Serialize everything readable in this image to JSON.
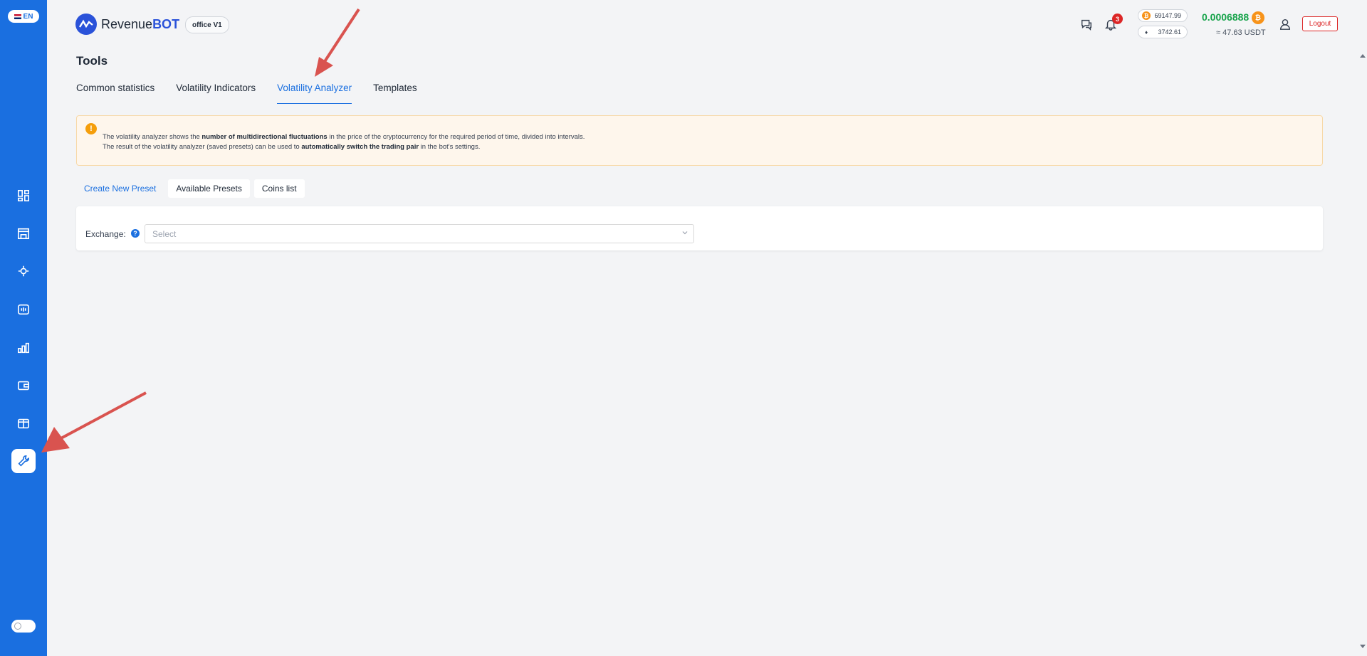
{
  "sidebar": {
    "lang": "EN",
    "items": [
      {
        "icon": "dashboard-icon"
      },
      {
        "icon": "marketplace-icon"
      },
      {
        "icon": "bots-icon"
      },
      {
        "icon": "terminal-icon"
      },
      {
        "icon": "statistics-icon"
      },
      {
        "icon": "wallet-icon"
      },
      {
        "icon": "tariffs-icon"
      },
      {
        "icon": "tools-icon",
        "active": true
      }
    ]
  },
  "header": {
    "brand": {
      "plain": "Revenue",
      "bold": "BOT"
    },
    "office": "office V1",
    "notifications": "3",
    "tickers": [
      {
        "coin": "₿",
        "color": "#f7931a",
        "value": "69147.99"
      },
      {
        "coin": "♦",
        "color": "#6b7280",
        "value": "3742.61"
      }
    ],
    "balance_btc": "0.0006888",
    "balance_usdt": "≈ 47.63 USDT",
    "logout": "Logout"
  },
  "page": {
    "title": "Tools",
    "tabs": [
      "Common statistics",
      "Volatility Indicators",
      "Volatility Analyzer",
      "Templates"
    ],
    "active_tab": 2
  },
  "alert": {
    "line1_pre": "The volatility analyzer shows the ",
    "line1_bold": "number of multidirectional fluctuations",
    "line1_post": " in the price of the cryptocurrency for the required period of time, divided into intervals.",
    "line2_pre": "The result of the volatility analyzer (saved presets) can be used to ",
    "line2_bold": "automatically switch the trading pair",
    "line2_post": " in the bot's settings."
  },
  "subtabs": [
    "Create New Preset",
    "Available Presets",
    "Coins list"
  ],
  "form": {
    "exchange_label": "Exchange:",
    "help": "?",
    "select_placeholder": "Select"
  }
}
